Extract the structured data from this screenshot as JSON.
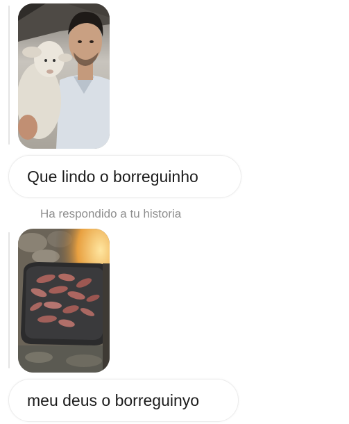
{
  "conversation": {
    "messages": [
      {
        "story_image": "man-holding-lamb-selfie",
        "text": "Que lindo o borreguinho"
      },
      {
        "status": "Ha respondido a tu historia",
        "story_image": "meat-grilling-on-griddle",
        "text": "meu deus o borreguinyo"
      }
    ]
  },
  "colors": {
    "background": "#ffffff",
    "bubble_border": "#ececec",
    "message_text": "#1b1b1b",
    "status_text": "#8e8e8e",
    "story_line": "#e4e4e4"
  }
}
